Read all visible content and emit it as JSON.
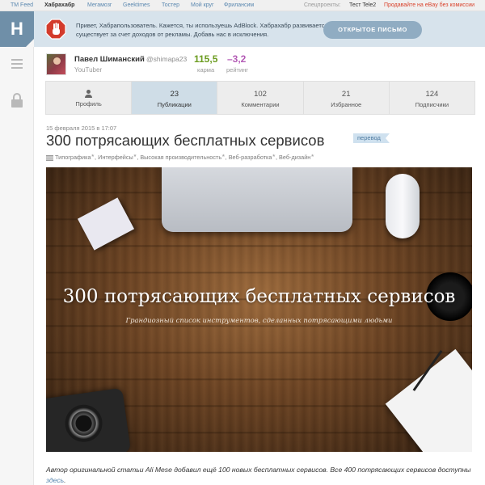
{
  "topnav": {
    "links": [
      {
        "label": "TM Feed",
        "active": false
      },
      {
        "label": "Хабрахабр",
        "active": true
      },
      {
        "label": "Мегамозг",
        "active": false
      },
      {
        "label": "Geektimes",
        "active": false
      },
      {
        "label": "Тостер",
        "active": false
      },
      {
        "label": "Мой круг",
        "active": false
      },
      {
        "label": "Фрилансим",
        "active": false
      }
    ],
    "special_label": "Спецпроекты:",
    "special_link": "Тест Tele2",
    "promo_link": "Продавайте на eBay без комиссии"
  },
  "sidebar": {
    "logo_letter": "H",
    "menu_icon": "hamburger-icon",
    "lock_icon": "lock-icon"
  },
  "banner": {
    "text": "Привет, Хабрапользователь. Кажется, ты используешь AdBlock. Хабрахабр развивается и существует за счет доходов от рекламы. Добавь нас в исключения.",
    "button": "ОТКРЫТОЕ ПИСЬМО",
    "icon": "stop-hand-icon"
  },
  "user": {
    "name": "Павел Шиманский",
    "nick": "@shimapa23",
    "role": "YouTuber",
    "karma_value": "115,5",
    "karma_label": "карма",
    "rating_value": "–3,2",
    "rating_label": "рейтинг"
  },
  "tabs": [
    {
      "num": "",
      "label": "Профиль",
      "icon": "person-icon",
      "active": false
    },
    {
      "num": "23",
      "label": "Публикации",
      "active": true
    },
    {
      "num": "102",
      "label": "Комментарии",
      "active": false
    },
    {
      "num": "21",
      "label": "Избранное",
      "active": false
    },
    {
      "num": "124",
      "label": "Подписчики",
      "active": false
    }
  ],
  "post": {
    "date": "15 февраля 2015 в 17:07",
    "title": "300 потрясающих бесплатных сервисов",
    "badge": "перевод",
    "hubs": [
      "Типографика",
      "Интерфейсы",
      "Высокая производительность",
      "Веб-разработка",
      "Веб-дизайн"
    ],
    "hero_title": "300 потрясающих бесплатных сервисов",
    "hero_subtitle": "Грандиозный список инструментов, сделанных потрясающими людьми",
    "intro_text": "Автор оригинальной статьи Ali Mese добавил ещё 100 новых бесплатных сервисов. Все 400 потрясающих сервисов доступны ",
    "intro_link": "здесь",
    "intro_end": "."
  }
}
